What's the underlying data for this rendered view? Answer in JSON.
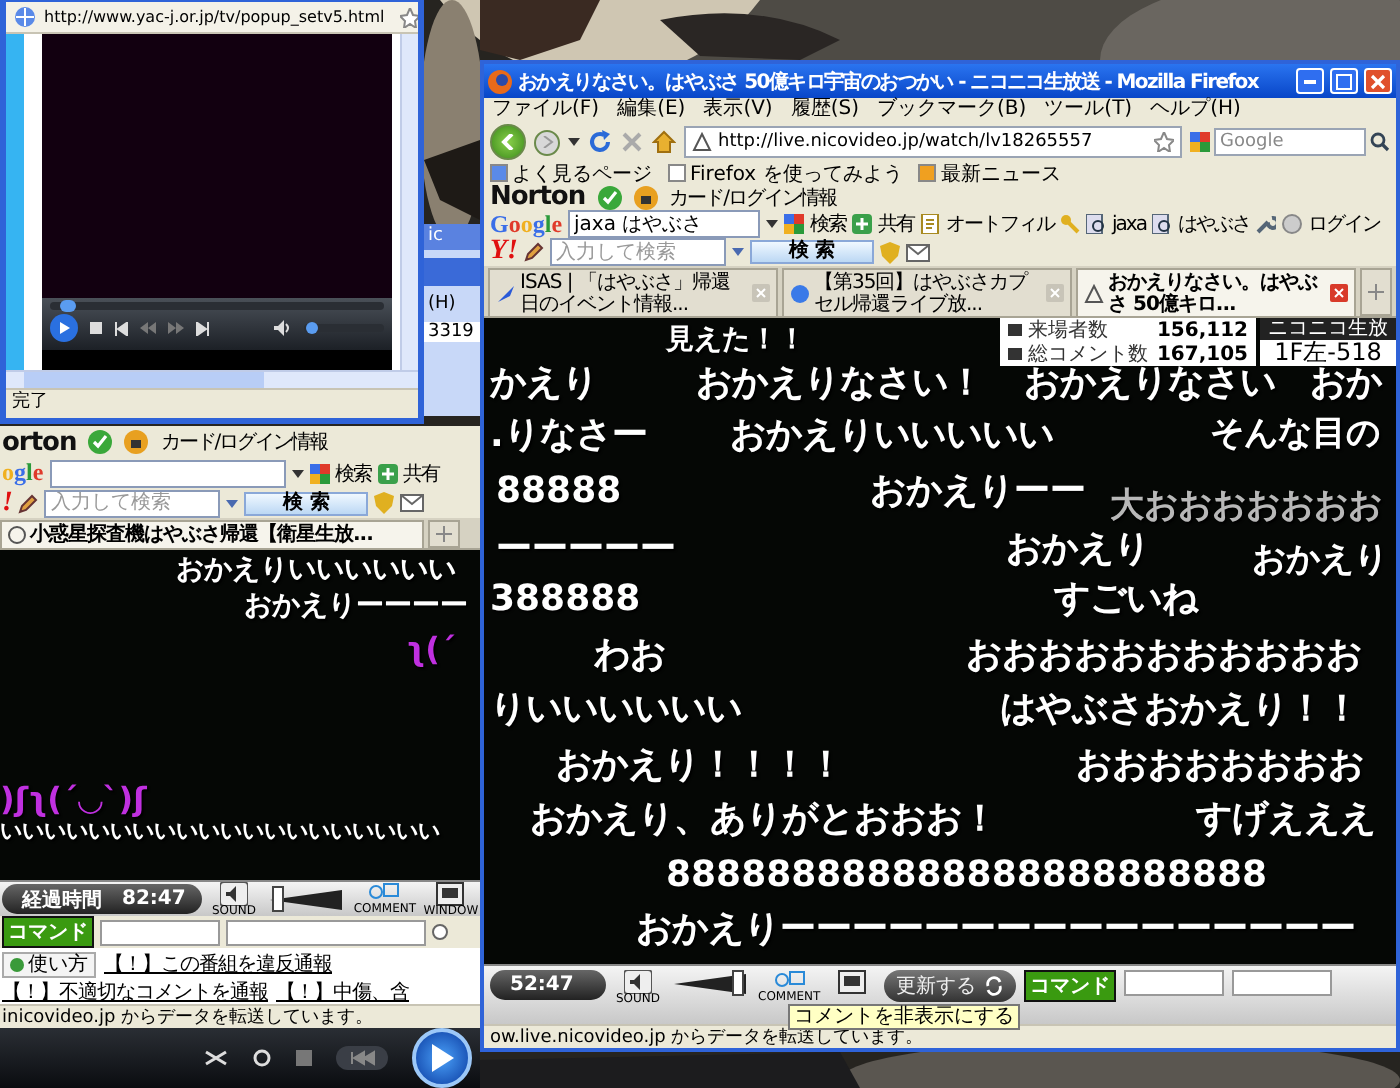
{
  "popup": {
    "url": "http://www.yac-j.or.jp/tv/popup_setv5.html",
    "seek": {
      "level": 0.03
    },
    "volume": {
      "level": 0.02
    },
    "status": "完了"
  },
  "peek": {
    "texts": [
      "ic",
      "(H)",
      "3319"
    ]
  },
  "back_window": {
    "norton": {
      "logo": "orton",
      "card": "カード/ログイン情報"
    },
    "google_bar": {
      "logo": "ogle",
      "items": [
        "検索",
        "共有"
      ]
    },
    "yahoo_bar": {
      "logo": "!",
      "placeholder": "入力して検索",
      "search": "検 索"
    },
    "tabs": [
      {
        "label": "小惑星探査機はやぶさ帰還【衛星生放...",
        "selected": true
      }
    ],
    "comments": [
      {
        "text": "おかえりいいいいいい",
        "color": "#ffffff"
      },
      {
        "text": "おかえりーーーー",
        "color": "#ffffff"
      },
      {
        "text": "ʅ(´",
        "color": "#c030e0"
      },
      {
        "text": ")ʃʅ(´◡`)ʃ",
        "color": "#c030e0"
      },
      {
        "text": "いいいいいいいいいいいいいいいいいいいい",
        "color": "#ffffff"
      }
    ],
    "player": {
      "elapsed_label": "経過時間",
      "elapsed": "82:47",
      "volume": {
        "level": 0.1
      },
      "icon_labels": [
        "SOUND",
        "COMMENT",
        "WINDOW"
      ],
      "command": "コマンド"
    },
    "help_button": "使い方",
    "links": [
      "【！】この番組を違反通報",
      "【！】不適切なコメントを通報",
      "【！】中傷、含"
    ],
    "status": "inicovideo.jp からデータを転送しています。"
  },
  "main_window": {
    "title": "おかえりなさい。はやぶさ 50億キロ宇宙のおつかい - ニコニコ生放送 - Mozilla Firefox",
    "menu": [
      "ファイル(F)",
      "編集(E)",
      "表示(V)",
      "履歴(S)",
      "ブックマーク(B)",
      "ツール(T)",
      "ヘルプ(H)"
    ],
    "url": "http://live.nicovideo.jp/watch/lv18265557",
    "search_placeholder": "Google",
    "bookmarks": [
      "よく見るページ",
      "Firefox を使ってみよう",
      "最新ニュース"
    ],
    "norton": {
      "logo": "Norton",
      "card": "カード/ログイン情報"
    },
    "google_bar": {
      "logo": "Google",
      "query": "jaxa はやぶさ",
      "items": [
        "検索",
        "共有",
        "オートフィル",
        "jaxa",
        "はやぶさ",
        "ログイン"
      ]
    },
    "yahoo_bar": {
      "logo": "Y!",
      "placeholder": "入力して検索",
      "search": "検 索"
    },
    "tabs": [
      {
        "label": "ISAS | 「はやぶさ」帰還日のイベント情報...",
        "selected": false
      },
      {
        "label": "【第35回】はやぶさカプセル帰還ライブ放...",
        "selected": false
      },
      {
        "label": "おかえりなさい。はやぶさ 50億キロ...",
        "selected": true
      }
    ],
    "stats": [
      {
        "label": "来場者数",
        "value": "156,112"
      },
      {
        "label": "総コメント数",
        "value": "167,105"
      }
    ],
    "channel": {
      "name": "ニコニコ生放",
      "seat": "1F左-518"
    },
    "comments": [
      {
        "text": "見えた！！",
        "color": "#ffffff"
      },
      {
        "text": "かえり",
        "color": "#ffffff"
      },
      {
        "text": "おかえりなさい！",
        "color": "#ffffff"
      },
      {
        "text": "おかえりなさい",
        "color": "#ffffff"
      },
      {
        "text": "おか",
        "color": "#ffffff"
      },
      {
        "text": ".りなさー",
        "color": "#ffffff"
      },
      {
        "text": "おかえりいいいいい",
        "color": "#ffffff"
      },
      {
        "text": "そんな目の",
        "color": "#ffffff"
      },
      {
        "text": "88888",
        "color": "#ffffff"
      },
      {
        "text": "おかえりーー",
        "color": "#ffffff"
      },
      {
        "text": "大おおおおおおお",
        "color": "#b8b8b8"
      },
      {
        "text": "ーーーーー",
        "color": "#ffffff"
      },
      {
        "text": "おかえり",
        "color": "#ffffff"
      },
      {
        "text": "おかえり",
        "color": "#ffffff"
      },
      {
        "text": "388888",
        "color": "#ffffff"
      },
      {
        "text": "すごいね",
        "color": "#ffffff"
      },
      {
        "text": "わお",
        "color": "#ffffff"
      },
      {
        "text": "おおおおおおおおおおお",
        "color": "#ffffff"
      },
      {
        "text": "りいいいいいい",
        "color": "#ffffff"
      },
      {
        "text": "はやぶさおかえり！！",
        "color": "#ffffff"
      },
      {
        "text": "おかえり！！！！",
        "color": "#ffffff"
      },
      {
        "text": "おおおおおおおお",
        "color": "#ffffff"
      },
      {
        "text": "おかえり、ありがとおおお！",
        "color": "#ffffff"
      },
      {
        "text": "すげえええ",
        "color": "#ffffff"
      },
      {
        "text": "888888888888888888888888",
        "color": "#ffffff"
      },
      {
        "text": "おかえりーーーーーーーーーーーーーーーー",
        "color": "#ffffff"
      }
    ],
    "player": {
      "elapsed": "52:47",
      "volume": {
        "level": 0.9
      },
      "icon_labels": [
        "SOUND",
        "COMMENT"
      ],
      "update": "更新する",
      "command": "コマンド",
      "tooltip": "コメントを非表示にする"
    },
    "status": "ow.live.nicovideo.jp からデータを転送しています。"
  }
}
